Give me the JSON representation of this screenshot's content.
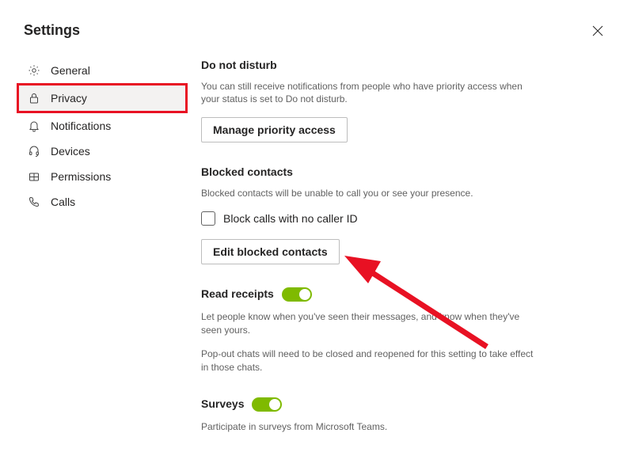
{
  "header": {
    "title": "Settings"
  },
  "sidebar": {
    "items": [
      {
        "label": "General",
        "icon": "gear"
      },
      {
        "label": "Privacy",
        "icon": "lock",
        "selected": true,
        "highlighted": true
      },
      {
        "label": "Notifications",
        "icon": "bell"
      },
      {
        "label": "Devices",
        "icon": "headset"
      },
      {
        "label": "Permissions",
        "icon": "package"
      },
      {
        "label": "Calls",
        "icon": "phone"
      }
    ]
  },
  "main": {
    "dnd": {
      "title": "Do not disturb",
      "desc": "You can still receive notifications from people who have priority access when your status is set to Do not disturb.",
      "button": "Manage priority access"
    },
    "blocked": {
      "title": "Blocked contacts",
      "desc": "Blocked contacts will be unable to call you or see your presence.",
      "checkbox_label": "Block calls with no caller ID",
      "button": "Edit blocked contacts"
    },
    "read_receipts": {
      "title": "Read receipts",
      "toggle": true,
      "desc1": "Let people know when you've seen their messages, and know when they've seen yours.",
      "desc2": "Pop-out chats will need to be closed and reopened for this setting to take effect in those chats."
    },
    "surveys": {
      "title": "Surveys",
      "toggle": true,
      "desc": "Participate in surveys from Microsoft Teams."
    }
  }
}
